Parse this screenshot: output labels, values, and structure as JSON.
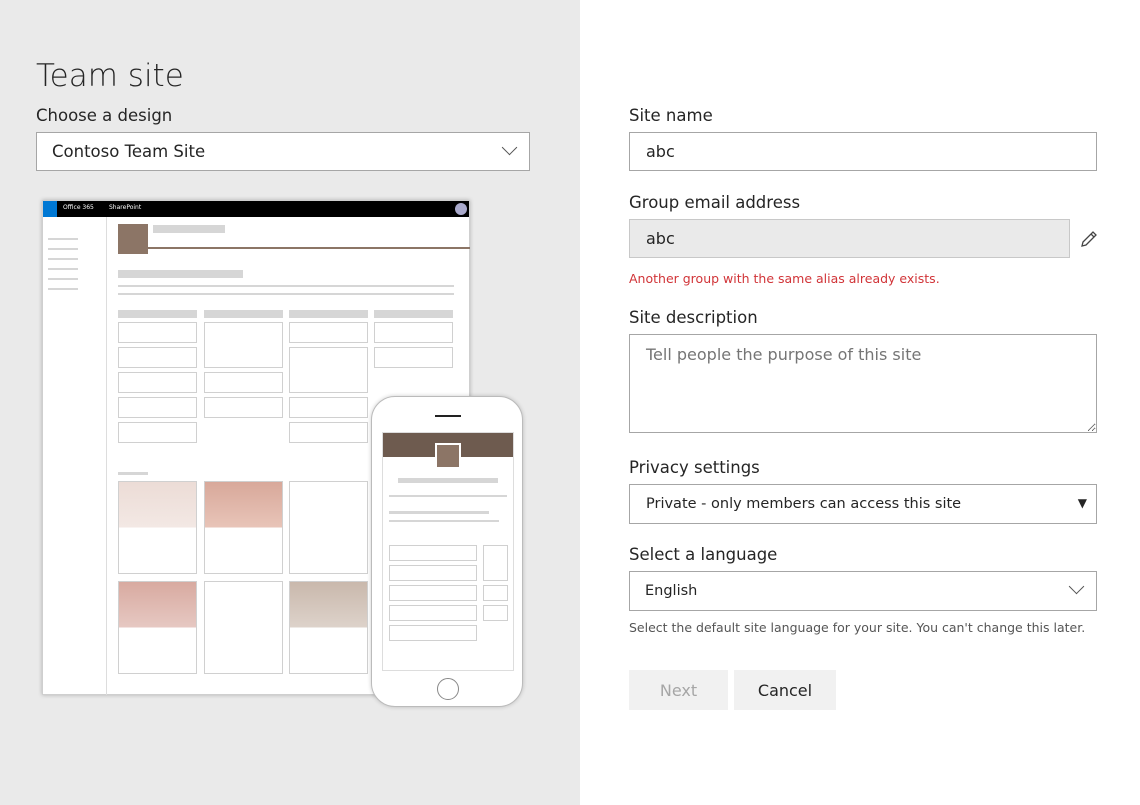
{
  "left": {
    "title": "Team site",
    "design_label": "Choose a design",
    "design_value": "Contoso Team Site",
    "preview": {
      "suite_label": "Office 365",
      "app_label": "SharePoint",
      "accent": "#8c7566"
    }
  },
  "form": {
    "site_name_label": "Site name",
    "site_name_value": "abc",
    "email_label": "Group email address",
    "email_value": "abc",
    "email_error": "Another group with the same alias already exists.",
    "description_label": "Site description",
    "description_placeholder": "Tell people the purpose of this site",
    "privacy_label": "Privacy settings",
    "privacy_value": "Private - only members can access this site",
    "language_label": "Select a language",
    "language_value": "English",
    "language_hint": "Select the default site language for your site. You can't change this later.",
    "next_label": "Next",
    "cancel_label": "Cancel"
  },
  "colors": {
    "error": "#d13438",
    "disabled_text": "#a6a6a6",
    "left_bg": "#eaeaea"
  }
}
